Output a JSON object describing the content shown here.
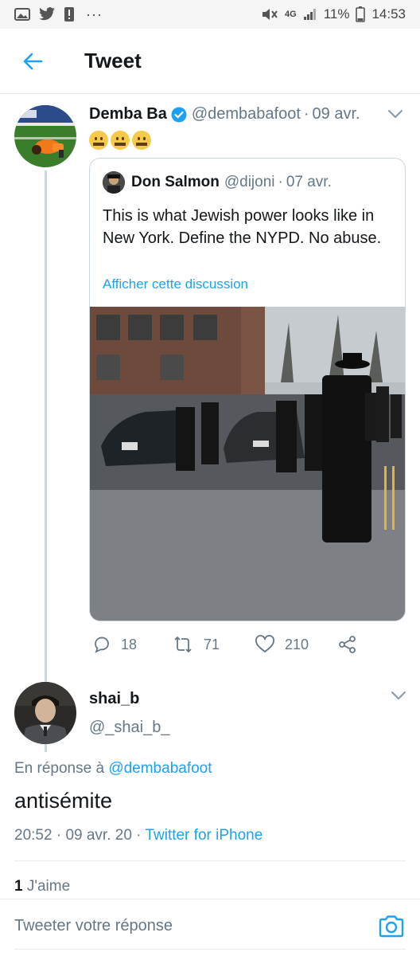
{
  "status_bar": {
    "battery": "11%",
    "time": "14:53",
    "network": "4G",
    "dots": "···"
  },
  "header": {
    "title": "Tweet"
  },
  "main_tweet": {
    "name": "Demba Ba",
    "handle": "@dembabafoot",
    "date": "09 avr.",
    "separator": "·",
    "emoji_count": 3,
    "quoted": {
      "name": "Don Salmon",
      "handle": "@dijoni",
      "date": "07 avr.",
      "text": "This is what Jewish power looks like in New York. Define the NYPD. No abuse.",
      "link": "Afficher cette discussion"
    },
    "actions": {
      "replies": "18",
      "retweets": "71",
      "likes": "210"
    }
  },
  "reply_tweet": {
    "name": "shai_b",
    "handle": "@_shai_b_",
    "in_reply_prefix": "En réponse à",
    "in_reply_mention": "@dembabafoot",
    "text": "antisémite",
    "time": "20:52",
    "date": "09 avr. 20",
    "client": "Twitter for iPhone",
    "likes_count": "1",
    "likes_label": "J'aime"
  },
  "compose": {
    "placeholder": "Tweeter votre réponse"
  },
  "colors": {
    "accent": "#1da1f2",
    "secondary_text": "#657786",
    "divider": "#e6ecf0"
  }
}
